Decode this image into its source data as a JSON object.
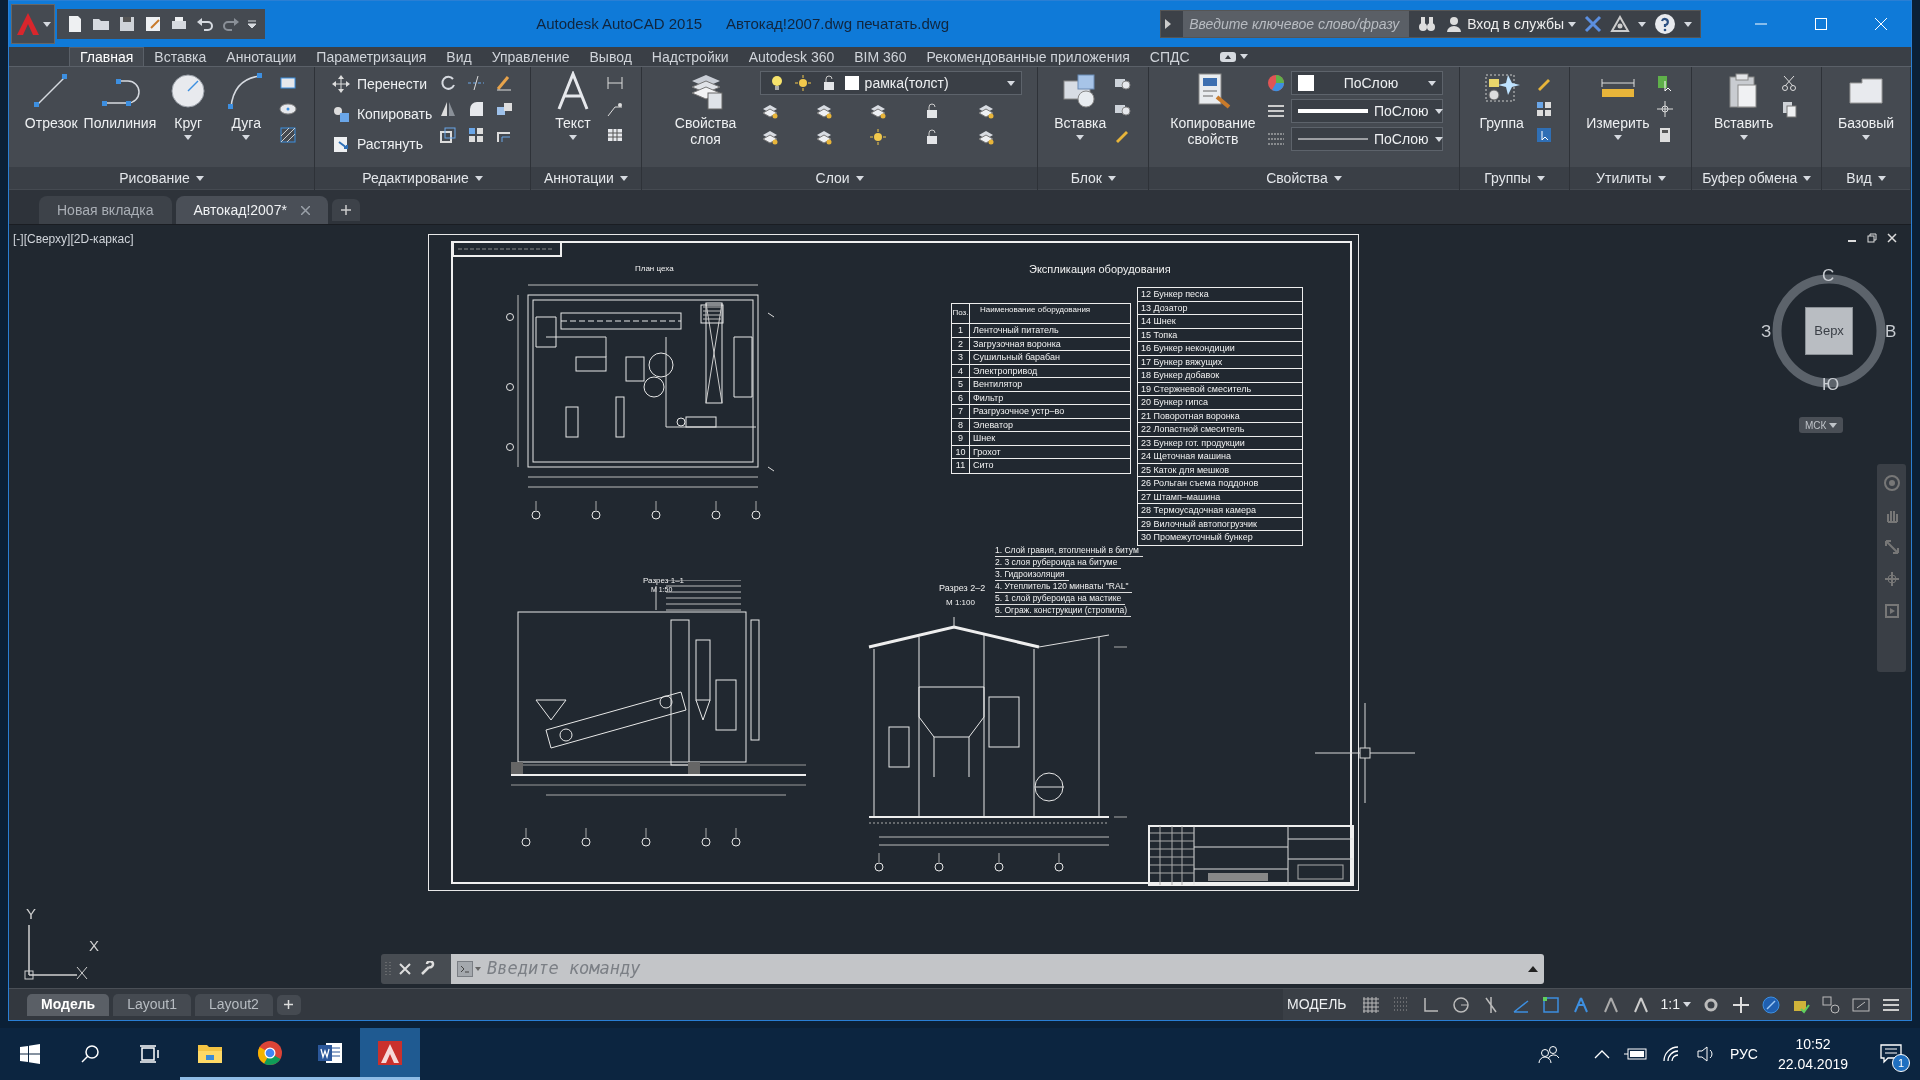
{
  "window": {
    "app_title": "Autodesk AutoCAD 2015",
    "file_title": "Автокад!2007.dwg печатать.dwg"
  },
  "infocenter": {
    "placeholder": "Введите ключевое слово/фразу",
    "sign_in": "Вход в службы"
  },
  "ribbon_tabs": [
    {
      "label": "Главная",
      "selected": true
    },
    {
      "label": "Вставка",
      "selected": false
    },
    {
      "label": "Аннотации",
      "selected": false
    },
    {
      "label": "Параметризация",
      "selected": false
    },
    {
      "label": "Вид",
      "selected": false
    },
    {
      "label": "Управление",
      "selected": false
    },
    {
      "label": "Вывод",
      "selected": false
    },
    {
      "label": "Надстройки",
      "selected": false
    },
    {
      "label": "Autodesk 360",
      "selected": false
    },
    {
      "label": "BIM 360",
      "selected": false
    },
    {
      "label": "Рекомендованные приложения",
      "selected": false
    },
    {
      "label": "СПДС",
      "selected": false
    }
  ],
  "panels": [
    {
      "title": "Рисование",
      "large": [
        {
          "label": "Отрезок",
          "dropdown": false
        },
        {
          "label": "Полилиния",
          "dropdown": false
        },
        {
          "label": "Круг",
          "dropdown": true
        },
        {
          "label": "Дуга",
          "dropdown": true
        }
      ]
    },
    {
      "title": "Редактирование",
      "small": [
        {
          "label": "Перенести"
        },
        {
          "label": "Копировать"
        },
        {
          "label": "Растянуть"
        }
      ]
    },
    {
      "title": "Аннотации",
      "large": [
        {
          "label": "Текст",
          "dropdown": true
        }
      ]
    },
    {
      "title": "Слои",
      "large": [
        {
          "label": "Свойства слоя",
          "dropdown": false
        }
      ],
      "dropdowns": [
        {
          "kind": "layer",
          "value": "рамка(толст)"
        }
      ]
    },
    {
      "title": "Блок",
      "large": [
        {
          "label": "Вставка",
          "dropdown": true
        }
      ]
    },
    {
      "title": "Свойства",
      "large": [
        {
          "label": "Копирование свойств",
          "dropdown": false
        }
      ],
      "dropdowns": [
        {
          "kind": "color",
          "value": "ПоСлою"
        },
        {
          "kind": "lineweight",
          "value": "ПоСлою"
        },
        {
          "kind": "linetype",
          "value": "ПоСлою"
        }
      ]
    },
    {
      "title": "Группы",
      "large": [
        {
          "label": "Группа",
          "dropdown": false
        }
      ]
    },
    {
      "title": "Утилиты",
      "large": [
        {
          "label": "Измерить",
          "dropdown": true
        }
      ]
    },
    {
      "title": "Буфер обмена",
      "large": [
        {
          "label": "Вставить",
          "dropdown": true
        }
      ]
    },
    {
      "title": "Вид",
      "large": [
        {
          "label": "Базовый",
          "dropdown": true
        }
      ]
    }
  ],
  "file_tabs": [
    {
      "label": "Новая вкладка",
      "selected": false,
      "closable": false
    },
    {
      "label": "Автокад!2007*",
      "selected": true,
      "closable": true
    }
  ],
  "viewport": {
    "label": "[-][Сверху][2D-каркас]"
  },
  "drawing": {
    "plan_title": "План цеха",
    "section1_title": "Разрез 1–1",
    "section1_scale": "М 1:50",
    "section2_title": "Разрез 2–2",
    "section2_scale": "М 1:100",
    "table_title": "Экспликация оборудования",
    "table_headers": [
      "Поз.",
      "Наименование оборудования"
    ],
    "table_rows": [
      [
        "1",
        "Ленточный питатель"
      ],
      [
        "2",
        "Загрузочная воронка"
      ],
      [
        "3",
        "Сушильный барабан"
      ],
      [
        "4",
        "Электропривод"
      ],
      [
        "5",
        "Вентилятор"
      ],
      [
        "6",
        "Фильтр"
      ],
      [
        "7",
        "Разгрузочное устр–во"
      ],
      [
        "8",
        "Элеватор"
      ],
      [
        "9",
        "Шнек"
      ],
      [
        "10",
        "Грохот"
      ],
      [
        "11",
        "Сито"
      ]
    ],
    "table_more": [
      "12 Бункер песка",
      "13 Дозатор",
      "14 Шнек",
      "15 Топка",
      "16 Бункер некондиции",
      "17 Бункер вяжущих",
      "18 Бункер добавок",
      "19 Стержневой смеситель",
      "20 Бункер гипса",
      "21 Поворотная воронка",
      "22 Лопастной смеситель",
      "23 Бункер гот. продукции",
      "24 Щеточная машина",
      "25 Каток для мешков",
      "26 Рольган съема поддонов",
      "27 Штамп–машина",
      "28 Термоусадочная камера",
      "29 Вилочный автопогрузчик",
      "30 Промежуточный бункер"
    ],
    "notes": [
      "1. Слой гравия, втопленный в битум",
      "2. 3 слоя рубероида на битуме",
      "3. Гидроизоляция",
      "4. Утеплитель 120 минваты \"RAL\"",
      "5. 1 слой рубероида на мастике",
      "6. Ограж. конструкции (стропила)"
    ]
  },
  "viewcube": {
    "face": "Верх",
    "north": "С",
    "south": "Ю",
    "west": "З",
    "east": "В",
    "ucs": "МСК"
  },
  "ucs_icon": {
    "x": "X",
    "y": "Y"
  },
  "command_line": {
    "placeholder": "Введите команду"
  },
  "layout_tabs": [
    {
      "label": "Модель",
      "selected": true
    },
    {
      "label": "Layout1",
      "selected": false
    },
    {
      "label": "Layout2",
      "selected": false
    }
  ],
  "status_bar": {
    "space": "МОДЕЛЬ",
    "scale": "1:1"
  },
  "taskbar": {
    "apps": [
      {
        "kind": "explorer",
        "selected": false
      },
      {
        "kind": "browser",
        "selected": false
      },
      {
        "kind": "word",
        "selected": false
      },
      {
        "kind": "cad",
        "selected": true
      }
    ],
    "language": "РУС",
    "time": "10:52",
    "date": "22.04.2019",
    "notifications": "1"
  }
}
